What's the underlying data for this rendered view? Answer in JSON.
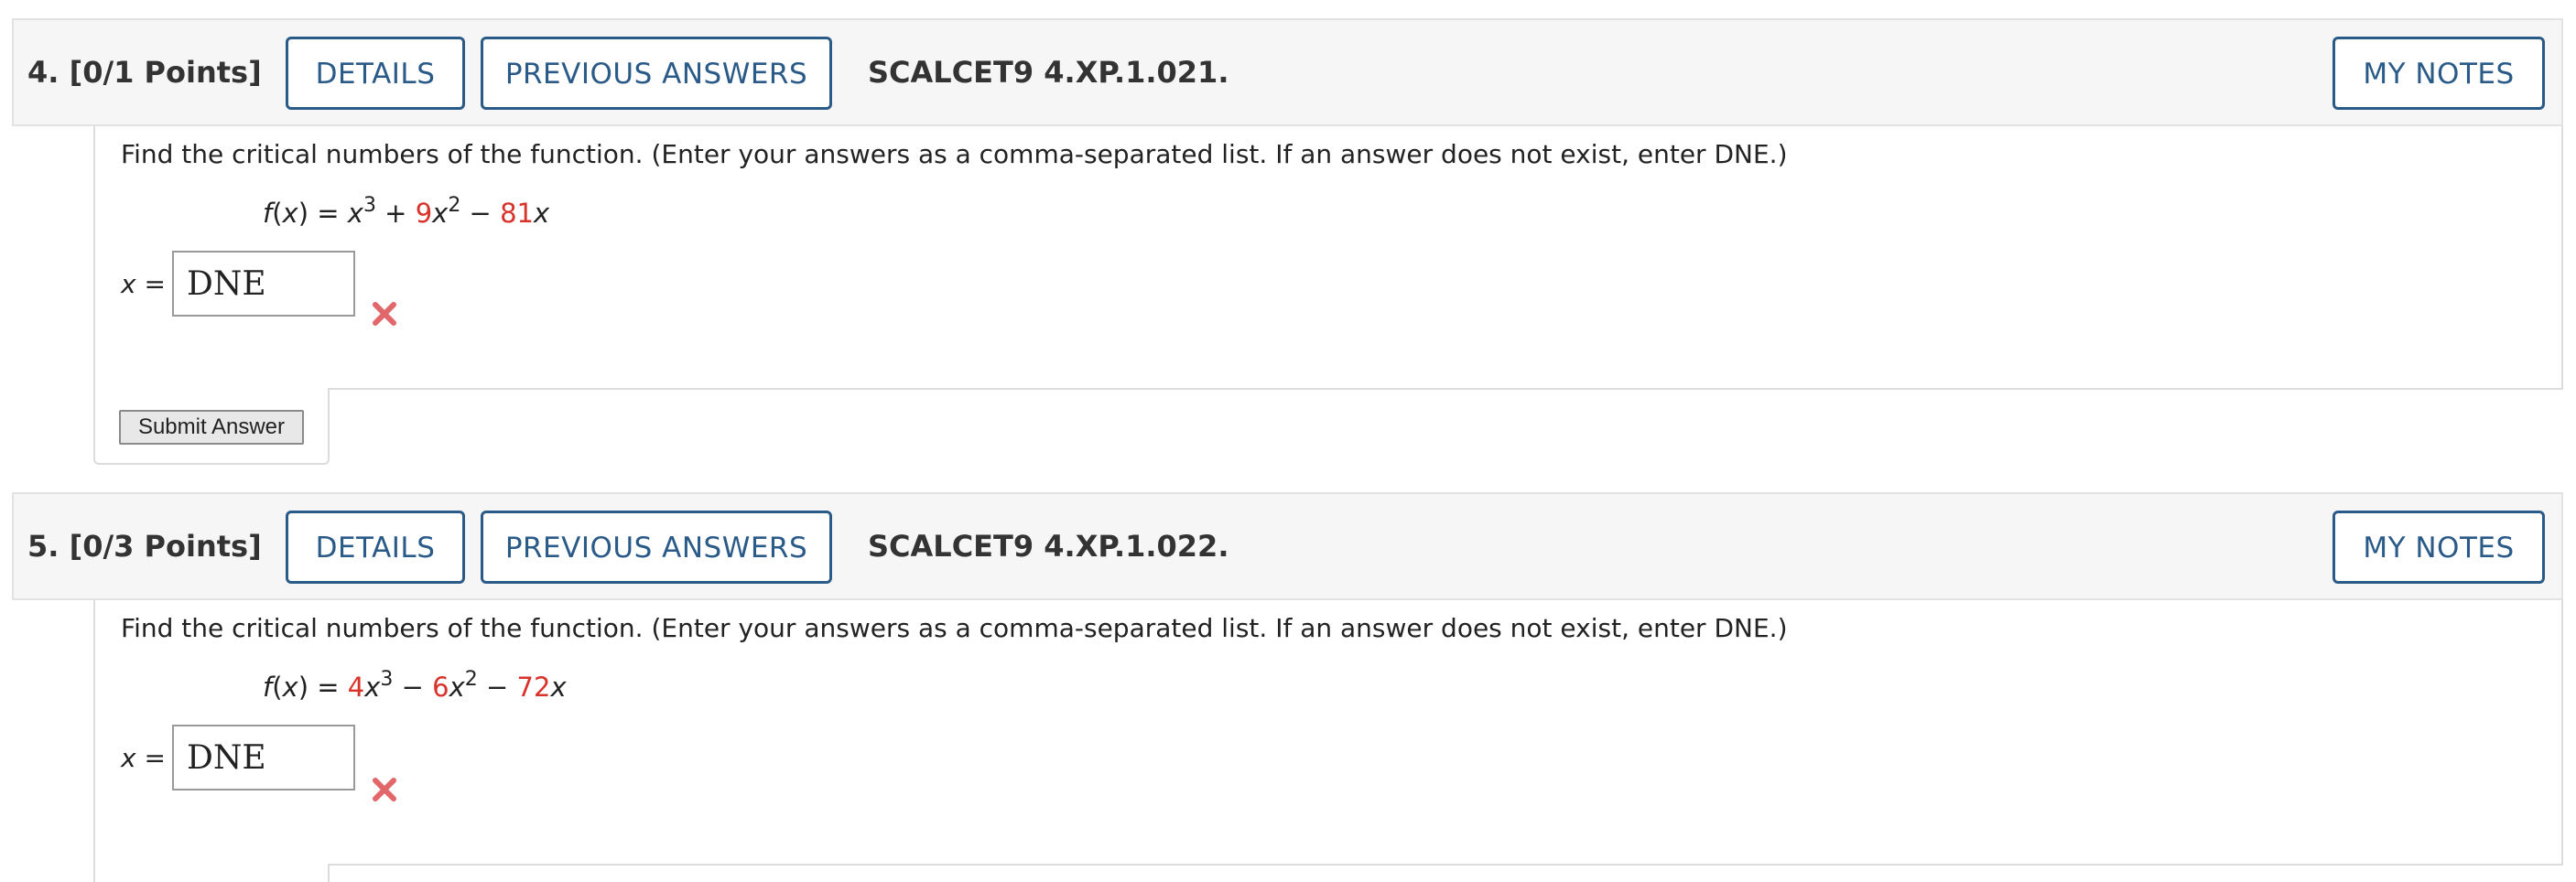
{
  "questions": [
    {
      "number_label": "4.",
      "points_label": "[0/1 Points]",
      "details_label": "DETAILS",
      "previous_answers_label": "PREVIOUS ANSWERS",
      "code": "SCALCET9 4.XP.1.021.",
      "my_notes_label": "MY NOTES",
      "prompt": "Find the critical numbers of the function. (Enter your answers as a comma-separated list. If an answer does not exist, enter DNE.)",
      "function": {
        "lhs": "f(x) = ",
        "c1": "",
        "p1": "x",
        "e1": "3",
        "op1": " + ",
        "c2": "9",
        "p2": "x",
        "e2": "2",
        "op2": " − ",
        "c3": "81",
        "p3": "x"
      },
      "answer_label": "x =",
      "answer_value": "DNE",
      "status": "incorrect",
      "submit_label": "Submit Answer"
    },
    {
      "number_label": "5.",
      "points_label": "[0/3 Points]",
      "details_label": "DETAILS",
      "previous_answers_label": "PREVIOUS ANSWERS",
      "code": "SCALCET9 4.XP.1.022.",
      "my_notes_label": "MY NOTES",
      "prompt": "Find the critical numbers of the function. (Enter your answers as a comma-separated list. If an answer does not exist, enter DNE.)",
      "function": {
        "lhs": "f(x) = ",
        "c1": "4",
        "p1": "x",
        "e1": "3",
        "op1": " − ",
        "c2": "6",
        "p2": "x",
        "e2": "2",
        "op2": " − ",
        "c3": "72",
        "p3": "x"
      },
      "answer_label": "x =",
      "answer_value": "DNE",
      "status": "incorrect"
    }
  ],
  "colors": {
    "accent": "#2a5a88",
    "coefficient": "#d8322a",
    "incorrect_mark": "#e2676b",
    "header_bg": "#f6f6f6"
  },
  "icons": {
    "incorrect": "x-mark-icon"
  }
}
